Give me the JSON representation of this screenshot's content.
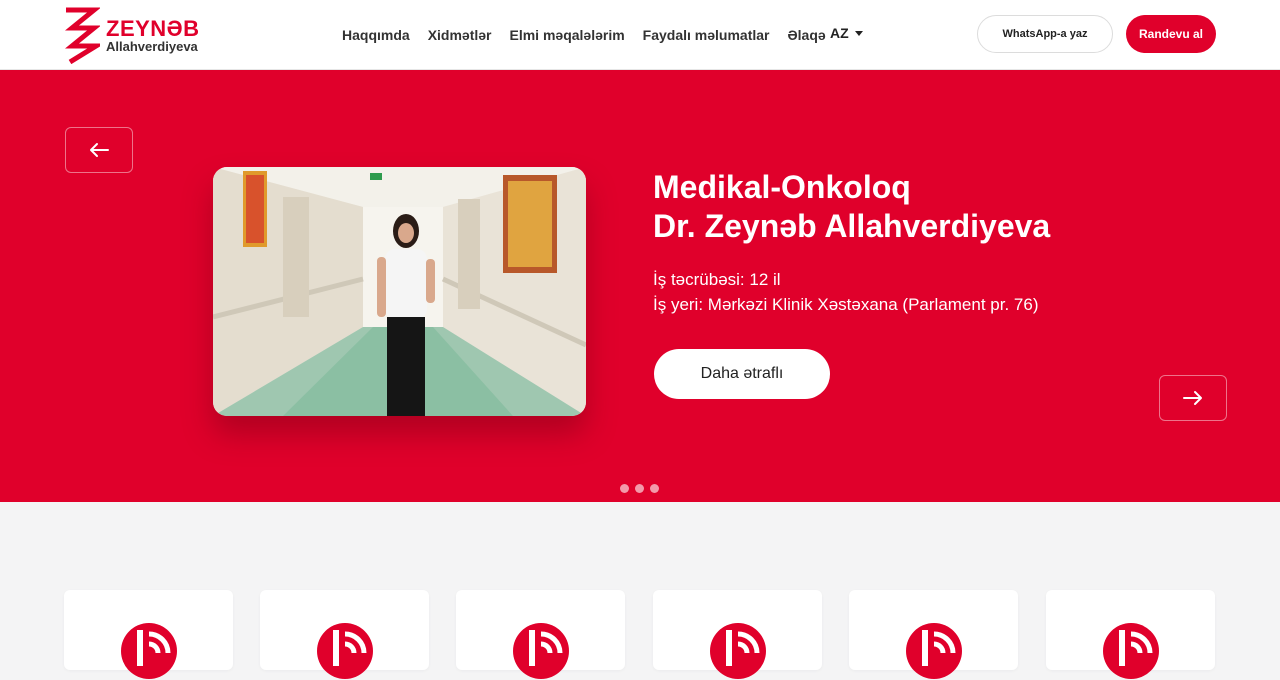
{
  "brand": {
    "name": "ZEYNƏB",
    "subtitle": "Allahverdiyeva",
    "color": "#e0002b"
  },
  "nav": {
    "items": [
      {
        "label": "Haqqımda"
      },
      {
        "label": "Xidmətlər"
      },
      {
        "label": "Elmi məqalələrim"
      },
      {
        "label": "Faydalı məlumatlar"
      },
      {
        "label": "Əlaqə"
      }
    ],
    "language": "AZ"
  },
  "header_actions": {
    "whatsapp_label": "WhatsApp-a yaz",
    "appointment_label": "Randevu al"
  },
  "hero": {
    "title_line1": "Medikal-Onkoloq",
    "title_line2": "Dr. Zeynəb Allahverdiyeva",
    "experience": "İş təcrübəsi: 12 il",
    "workplace": "İş yeri: Mərkəzi Klinik Xəstəxana (Parlament pr. 76)",
    "more_label": "Daha ətraflı",
    "slide_count": 3,
    "prev_icon": "arrow-left-icon",
    "next_icon": "arrow-right-icon"
  },
  "cards": {
    "count": 6,
    "icon": "service-logo-icon"
  }
}
